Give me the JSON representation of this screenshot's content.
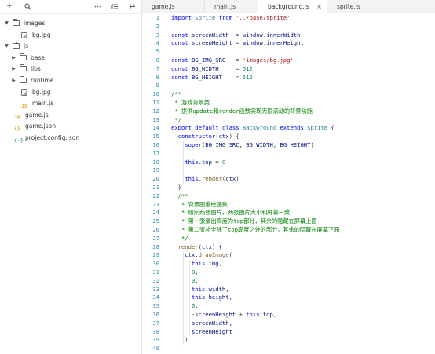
{
  "sidebar": {
    "toolbar": {
      "add_icon": "plus-icon",
      "search_icon": "search-icon",
      "more_icon": "ellipsis-icon",
      "collapse_icon": "collapse-icon",
      "layout_icon": "layout-icon"
    },
    "tree": [
      {
        "label": "images",
        "kind": "folder",
        "expanded": true,
        "depth": 0
      },
      {
        "label": "bg.jpg",
        "kind": "image",
        "depth": 1
      },
      {
        "label": "js",
        "kind": "folder",
        "expanded": true,
        "depth": 0
      },
      {
        "label": "base",
        "kind": "folder",
        "expanded": false,
        "depth": 1
      },
      {
        "label": "libs",
        "kind": "folder",
        "expanded": false,
        "depth": 1
      },
      {
        "label": "runtime",
        "kind": "folder",
        "expanded": false,
        "depth": 1
      },
      {
        "label": "bg.jpg",
        "kind": "image",
        "depth": 1
      },
      {
        "label": "main.js",
        "kind": "js",
        "depth": 1
      },
      {
        "label": "game.js",
        "kind": "js",
        "depth": 0
      },
      {
        "label": "game.json",
        "kind": "json",
        "depth": 0
      },
      {
        "label": "project.config.json",
        "kind": "config",
        "depth": 0
      }
    ]
  },
  "tabs": [
    {
      "label": "game.js",
      "active": false
    },
    {
      "label": "main.js",
      "active": false
    },
    {
      "label": "background.js",
      "active": true,
      "close": "×"
    },
    {
      "label": "sprite.js",
      "active": false
    }
  ],
  "editor": {
    "lines": [
      {
        "n": "1",
        "tokens": [
          [
            "k",
            "import "
          ],
          [
            "t",
            "Sprite "
          ],
          [
            "k",
            "from "
          ],
          [
            "s",
            "'../base/sprite'"
          ]
        ]
      },
      {
        "n": "2",
        "tokens": []
      },
      {
        "n": "3",
        "tokens": [
          [
            "k",
            "const "
          ],
          [
            "v",
            "screenWidth  "
          ],
          [
            "p",
            "= "
          ],
          [
            "v",
            "window"
          ],
          [
            "p",
            "."
          ],
          [
            "v",
            "innerWidth"
          ]
        ]
      },
      {
        "n": "4",
        "tokens": [
          [
            "k",
            "const "
          ],
          [
            "v",
            "screenHeight "
          ],
          [
            "p",
            "= "
          ],
          [
            "v",
            "window"
          ],
          [
            "p",
            "."
          ],
          [
            "v",
            "innerHeight"
          ]
        ]
      },
      {
        "n": "5",
        "tokens": []
      },
      {
        "n": "6",
        "tokens": [
          [
            "k",
            "const "
          ],
          [
            "v",
            "BG_IMG_SRC   "
          ],
          [
            "p",
            "= "
          ],
          [
            "s",
            "'images/bg.jpg'"
          ]
        ]
      },
      {
        "n": "7",
        "tokens": [
          [
            "k",
            "const "
          ],
          [
            "v",
            "BG_WIDTH     "
          ],
          [
            "p",
            "= "
          ],
          [
            "n",
            "512"
          ]
        ]
      },
      {
        "n": "8",
        "tokens": [
          [
            "k",
            "const "
          ],
          [
            "v",
            "BG_HEIGHT    "
          ],
          [
            "p",
            "= "
          ],
          [
            "n",
            "512"
          ]
        ]
      },
      {
        "n": "9",
        "tokens": []
      },
      {
        "n": "10",
        "tokens": [
          [
            "c",
            "/**"
          ]
        ]
      },
      {
        "n": "11",
        "tokens": [
          [
            "c",
            " * 游戏背景类"
          ]
        ]
      },
      {
        "n": "12",
        "tokens": [
          [
            "c",
            " * 提供update和render函数实现无限滚动的背景功能"
          ]
        ]
      },
      {
        "n": "13",
        "tokens": [
          [
            "c",
            " */"
          ]
        ]
      },
      {
        "n": "14",
        "tokens": [
          [
            "k",
            "export default class "
          ],
          [
            "t",
            "BackGround "
          ],
          [
            "k",
            "extends "
          ],
          [
            "t",
            "Sprite "
          ],
          [
            "p",
            "{"
          ]
        ]
      },
      {
        "n": "15",
        "tokens": [
          [
            "p",
            "  "
          ],
          [
            "k",
            "constructor"
          ],
          [
            "p",
            "("
          ],
          [
            "v",
            "ctx"
          ],
          [
            "p",
            ") {"
          ]
        ]
      },
      {
        "n": "16",
        "tokens": [
          [
            "p",
            "    "
          ],
          [
            "k",
            "super"
          ],
          [
            "p",
            "("
          ],
          [
            "v",
            "BG_IMG_SRC"
          ],
          [
            "p",
            ", "
          ],
          [
            "v",
            "BG_WIDTH"
          ],
          [
            "p",
            ", "
          ],
          [
            "v",
            "BG_HEIGHT"
          ],
          [
            "p",
            ")"
          ]
        ]
      },
      {
        "n": "17",
        "tokens": []
      },
      {
        "n": "18",
        "tokens": [
          [
            "p",
            "    "
          ],
          [
            "k",
            "this"
          ],
          [
            "p",
            "."
          ],
          [
            "v",
            "top "
          ],
          [
            "p",
            "= "
          ],
          [
            "n",
            "0"
          ]
        ]
      },
      {
        "n": "19",
        "tokens": []
      },
      {
        "n": "20",
        "tokens": [
          [
            "p",
            "    "
          ],
          [
            "k",
            "this"
          ],
          [
            "p",
            "."
          ],
          [
            "f",
            "render"
          ],
          [
            "p",
            "("
          ],
          [
            "v",
            "ctx"
          ],
          [
            "p",
            ")"
          ]
        ]
      },
      {
        "n": "21",
        "tokens": [
          [
            "p",
            "  }"
          ]
        ]
      },
      {
        "n": "22",
        "tokens": [
          [
            "c",
            "  /**"
          ]
        ]
      },
      {
        "n": "23",
        "tokens": [
          [
            "c",
            "   * 背景图重绘函数"
          ]
        ]
      },
      {
        "n": "24",
        "tokens": [
          [
            "c",
            "   * 绘制两张图片，两张图片大小和屏幕一致"
          ]
        ]
      },
      {
        "n": "25",
        "tokens": [
          [
            "c",
            "   * 第一张漏出高度为top部分，其余的隐藏在屏幕上面"
          ]
        ]
      },
      {
        "n": "26",
        "tokens": [
          [
            "c",
            "   * 第二张补全除了top高度之外的部分，其余的隐藏在屏幕下面"
          ]
        ]
      },
      {
        "n": "27",
        "tokens": [
          [
            "c",
            "   */"
          ]
        ]
      },
      {
        "n": "28",
        "tokens": [
          [
            "p",
            "  "
          ],
          [
            "f",
            "render"
          ],
          [
            "p",
            "("
          ],
          [
            "v",
            "ctx"
          ],
          [
            "p",
            ") {"
          ]
        ]
      },
      {
        "n": "29",
        "tokens": [
          [
            "p",
            "    "
          ],
          [
            "v",
            "ctx"
          ],
          [
            "p",
            "."
          ],
          [
            "f",
            "drawImage"
          ],
          [
            "p",
            "("
          ]
        ]
      },
      {
        "n": "30",
        "tokens": [
          [
            "p",
            "      "
          ],
          [
            "k",
            "this"
          ],
          [
            "p",
            "."
          ],
          [
            "v",
            "img"
          ],
          [
            "p",
            ","
          ]
        ]
      },
      {
        "n": "31",
        "tokens": [
          [
            "p",
            "      "
          ],
          [
            "n",
            "0"
          ],
          [
            "p",
            ","
          ]
        ]
      },
      {
        "n": "32",
        "tokens": [
          [
            "p",
            "      "
          ],
          [
            "n",
            "0"
          ],
          [
            "p",
            ","
          ]
        ]
      },
      {
        "n": "33",
        "tokens": [
          [
            "p",
            "      "
          ],
          [
            "k",
            "this"
          ],
          [
            "p",
            "."
          ],
          [
            "v",
            "width"
          ],
          [
            "p",
            ","
          ]
        ]
      },
      {
        "n": "34",
        "tokens": [
          [
            "p",
            "      "
          ],
          [
            "k",
            "this"
          ],
          [
            "p",
            "."
          ],
          [
            "v",
            "height"
          ],
          [
            "p",
            ","
          ]
        ]
      },
      {
        "n": "35",
        "tokens": [
          [
            "p",
            "      "
          ],
          [
            "n",
            "0"
          ],
          [
            "p",
            ","
          ]
        ]
      },
      {
        "n": "36",
        "tokens": [
          [
            "p",
            "      -"
          ],
          [
            "v",
            "screenHeight "
          ],
          [
            "p",
            "+ "
          ],
          [
            "k",
            "this"
          ],
          [
            "p",
            "."
          ],
          [
            "v",
            "top"
          ],
          [
            "p",
            ","
          ]
        ]
      },
      {
        "n": "37",
        "tokens": [
          [
            "p",
            "      "
          ],
          [
            "v",
            "screenWidth"
          ],
          [
            "p",
            ","
          ]
        ]
      },
      {
        "n": "38",
        "tokens": [
          [
            "p",
            "      "
          ],
          [
            "v",
            "screenHeight"
          ]
        ]
      },
      {
        "n": "39",
        "tokens": [
          [
            "p",
            "    )"
          ]
        ]
      },
      {
        "n": "40",
        "tokens": []
      }
    ]
  }
}
